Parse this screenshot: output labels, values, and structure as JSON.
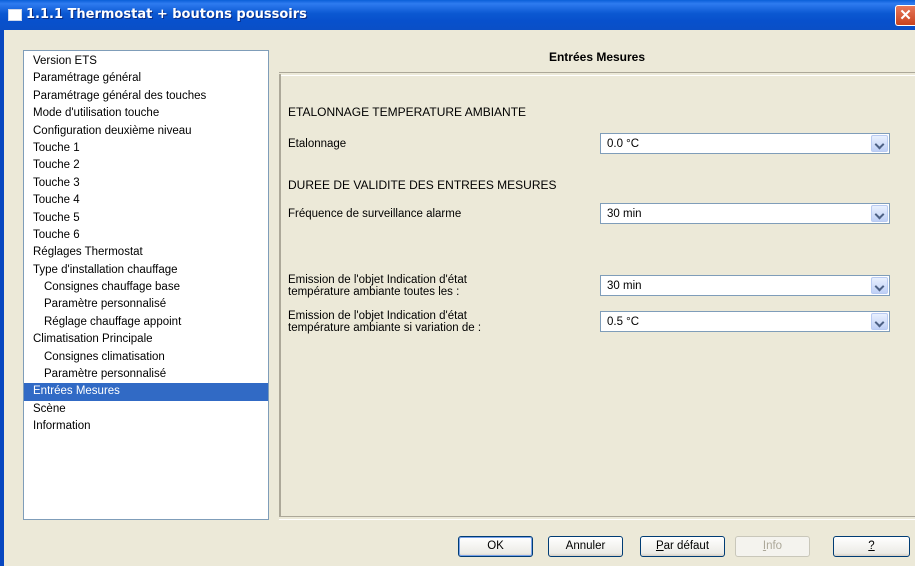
{
  "window": {
    "title": "1.1.1 Thermostat + boutons poussoirs",
    "close_glyph": "✕"
  },
  "tree": {
    "items": [
      {
        "label": "Version ETS",
        "level": 0
      },
      {
        "label": "Paramétrage général",
        "level": 0
      },
      {
        "label": "Paramétrage général des touches",
        "level": 0
      },
      {
        "label": "Mode d'utilisation touche",
        "level": 0
      },
      {
        "label": "Configuration deuxième niveau",
        "level": 0
      },
      {
        "label": "Touche 1",
        "level": 0
      },
      {
        "label": "Touche 2",
        "level": 0
      },
      {
        "label": "Touche 3",
        "level": 0
      },
      {
        "label": "Touche 4",
        "level": 0
      },
      {
        "label": "Touche 5",
        "level": 0
      },
      {
        "label": "Touche 6",
        "level": 0
      },
      {
        "label": "Réglages Thermostat",
        "level": 0
      },
      {
        "label": "Type d'installation chauffage",
        "level": 0
      },
      {
        "label": "Consignes chauffage base",
        "level": 1
      },
      {
        "label": "Paramètre personnalisé",
        "level": 1
      },
      {
        "label": "Réglage chauffage appoint",
        "level": 1
      },
      {
        "label": "Climatisation Principale",
        "level": 0
      },
      {
        "label": "Consignes climatisation",
        "level": 1
      },
      {
        "label": "Paramètre personnalisé",
        "level": 1
      },
      {
        "label": "Entrées Mesures",
        "level": 0,
        "selected": true
      },
      {
        "label": "Scène",
        "level": 0
      },
      {
        "label": "Information",
        "level": 0
      }
    ]
  },
  "panel": {
    "title": "Entrées Mesures",
    "section1": "ETALONNAGE TEMPERATURE AMBIANTE",
    "section2": "DUREE DE VALIDITE DES ENTREES MESURES",
    "params": [
      {
        "label1": "Etalonnage",
        "label2": "",
        "value": "0.0 °C"
      },
      {
        "label1": "Fréquence de surveillance alarme",
        "label2": "",
        "value": "30 min"
      },
      {
        "label1": "Emission de l'objet Indication d'état",
        "label2": "température ambiante toutes les :",
        "value": "30 min"
      },
      {
        "label1": "Emission de l'objet Indication d'état",
        "label2": "température ambiante si variation de :",
        "value": "0.5 °C"
      }
    ]
  },
  "buttons": {
    "ok": "OK",
    "annuler": "Annuler",
    "par_defaut_mnemonic": "P",
    "par_defaut_rest": "ar défaut",
    "info_mnemonic": "I",
    "info_rest": "nfo",
    "help": "?"
  },
  "colors": {
    "selection": "#316AC5",
    "titlebar": "#0A5FD8",
    "dialog_bg": "#ECE9D8"
  }
}
